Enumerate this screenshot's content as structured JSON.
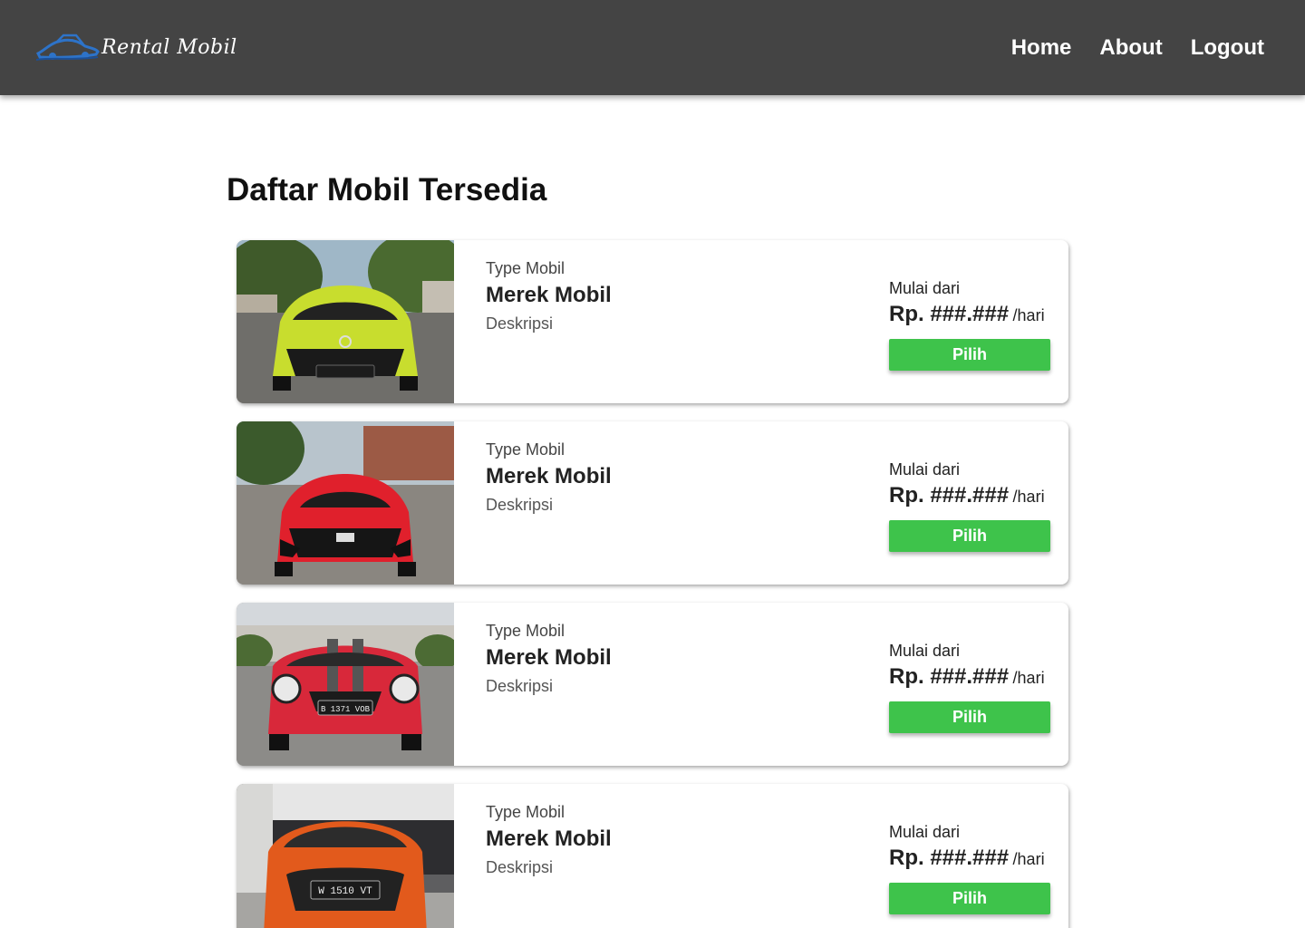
{
  "navbar": {
    "brand": "Rental Mobil",
    "logo_icon": "car-icon",
    "links": [
      {
        "label": "Home"
      },
      {
        "label": "About"
      },
      {
        "label": "Logout"
      }
    ]
  },
  "page": {
    "title": "Daftar Mobil Tersedia"
  },
  "cars": [
    {
      "type": "Type Mobil",
      "brand": "Merek Mobil",
      "description": "Deskripsi",
      "price_label": "Mulai dari",
      "price": "Rp. ###.###",
      "price_unit": "/hari",
      "button": "Pilih",
      "car_color": "#c8dd2e"
    },
    {
      "type": "Type Mobil",
      "brand": "Merek Mobil",
      "description": "Deskripsi",
      "price_label": "Mulai dari",
      "price": "Rp. ###.###",
      "price_unit": "/hari",
      "button": "Pilih",
      "car_color": "#e0202c"
    },
    {
      "type": "Type Mobil",
      "brand": "Merek Mobil",
      "description": "Deskripsi",
      "price_label": "Mulai dari",
      "price": "Rp. ###.###",
      "price_unit": "/hari",
      "button": "Pilih",
      "car_color": "#d8283a",
      "plate": "B 1371 VOB"
    },
    {
      "type": "Type Mobil",
      "brand": "Merek Mobil",
      "description": "Deskripsi",
      "price_label": "Mulai dari",
      "price": "Rp. ###.###",
      "price_unit": "/hari",
      "button": "Pilih",
      "car_color": "#e25a1c",
      "plate": "W 1510 VT"
    }
  ],
  "colors": {
    "navbar": "#444444",
    "button": "#3ec34b",
    "logo": "#2d73c9"
  }
}
